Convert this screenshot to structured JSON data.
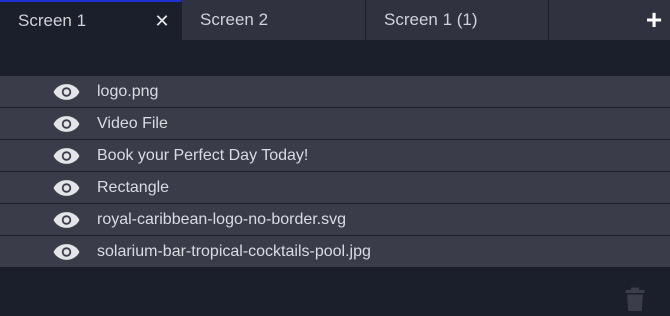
{
  "tabs": [
    {
      "label": "Screen 1",
      "active": true,
      "close_icon": "close-icon"
    },
    {
      "label": "Screen 2",
      "active": false
    },
    {
      "label": "Screen 1 (1)",
      "active": false
    }
  ],
  "add_tab_icon": "plus-icon",
  "layers": [
    {
      "label": "logo.png",
      "icon": "eye-icon"
    },
    {
      "label": "Video File",
      "icon": "eye-icon"
    },
    {
      "label": "Book your Perfect Day Today!",
      "icon": "eye-icon"
    },
    {
      "label": "Rectangle",
      "icon": "eye-icon"
    },
    {
      "label": "royal-caribbean-logo-no-border.svg",
      "icon": "eye-icon"
    },
    {
      "label": "solarium-bar-tropical-cocktails-pool.jpg",
      "icon": "eye-icon"
    }
  ],
  "delete_icon": "trash-icon",
  "colors": {
    "background": "#1b1e2b",
    "row": "#3a3d49",
    "tab": "#30333f",
    "active_tab_accent": "#1f2fd0"
  }
}
